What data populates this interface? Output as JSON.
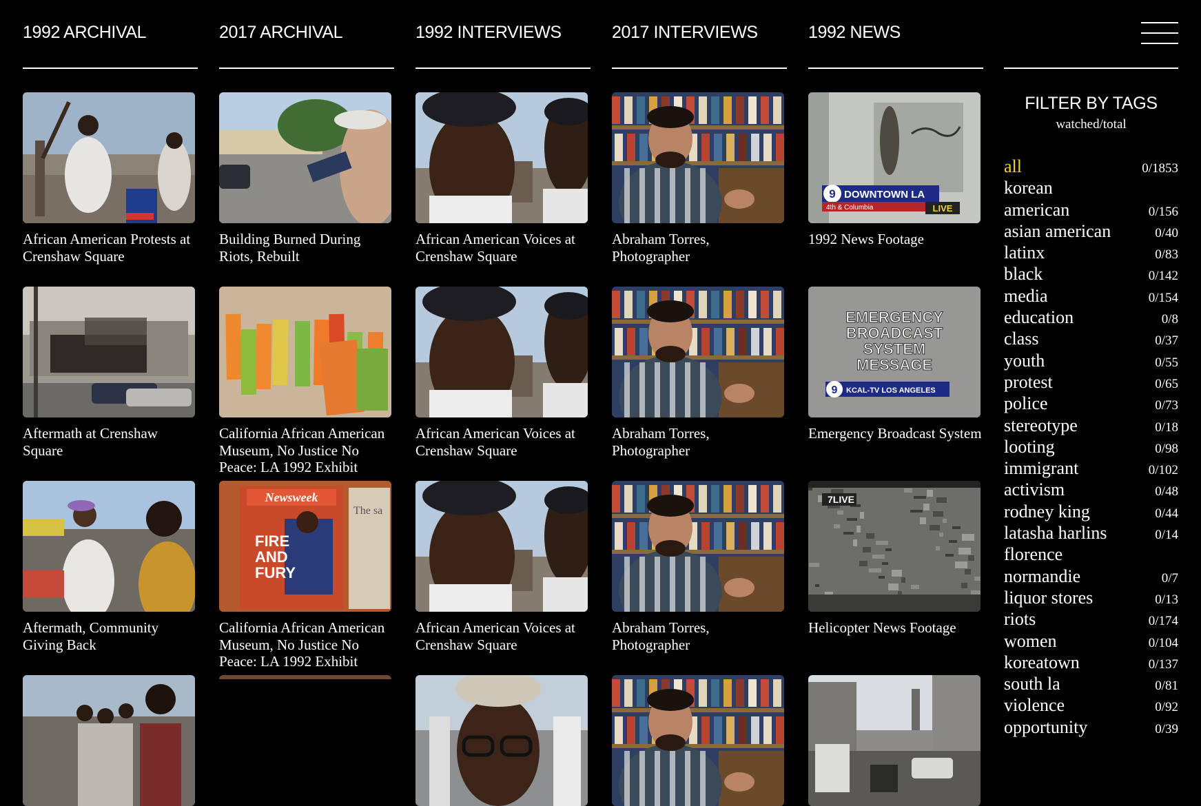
{
  "columns": [
    {
      "title": "1992 ARCHIVAL",
      "cards": [
        {
          "caption": "African American Protests at Crenshaw Square",
          "scene": "protest"
        },
        {
          "caption": "Aftermath at Crenshaw Square",
          "scene": "aftermath"
        },
        {
          "caption": "Aftermath, Community Giving Back",
          "scene": "crowd"
        },
        {
          "caption": "",
          "scene": "crowd2"
        }
      ]
    },
    {
      "title": "2017 ARCHIVAL",
      "cards": [
        {
          "caption": "Building Burned During Riots, Rebuilt",
          "scene": "street"
        },
        {
          "caption": "California African American Museum, No Justice No Peace: LA 1992 Exhibit",
          "scene": "tags"
        },
        {
          "caption": "California African American Museum, No Justice No Peace: LA 1992 Exhibit",
          "scene": "magazine"
        },
        {
          "caption": "",
          "scene": "dark"
        }
      ]
    },
    {
      "title": "1992 INTERVIEWS",
      "cards": [
        {
          "caption": "African American Voices at Crenshaw Square",
          "scene": "face"
        },
        {
          "caption": "African American Voices at Crenshaw Square",
          "scene": "face"
        },
        {
          "caption": "African American Voices at Crenshaw Square",
          "scene": "face"
        },
        {
          "caption": "",
          "scene": "face2"
        }
      ]
    },
    {
      "title": "2017 INTERVIEWS",
      "cards": [
        {
          "caption": "Abraham Torres, Photographer",
          "scene": "books"
        },
        {
          "caption": "Abraham Torres, Photographer",
          "scene": "books"
        },
        {
          "caption": "Abraham Torres, Photographer",
          "scene": "books"
        },
        {
          "caption": "",
          "scene": "books"
        }
      ]
    },
    {
      "title": "1992 NEWS",
      "cards": [
        {
          "caption": "1992 News Footage",
          "scene": "news",
          "overlay": "DOWNTOWN LA",
          "overlay_sub": "4th & Columbia",
          "badge": "LIVE",
          "channel": "9"
        },
        {
          "caption": "Emergency Broadcast System",
          "scene": "ebs",
          "overlay": "EMERGENCY BROADCAST SYSTEM MESSAGE",
          "overlay_sub": "KCAL-TV LOS ANGELES",
          "channel": "9"
        },
        {
          "caption": "Helicopter News Footage",
          "scene": "heli",
          "badge": "LIVE",
          "channel": "7"
        },
        {
          "caption": "",
          "scene": "city"
        }
      ]
    }
  ],
  "menu": {
    "icon": "hamburger-menu-icon"
  },
  "filter": {
    "title": "FILTER BY TAGS",
    "subtitle": "watched/total",
    "tags": [
      {
        "name": "all",
        "count": "0/1853",
        "active": true
      },
      {
        "name": "korean",
        "count": ""
      },
      {
        "name": "american",
        "count": "0/156"
      },
      {
        "name": "asian american",
        "count": "0/40"
      },
      {
        "name": "latinx",
        "count": "0/83"
      },
      {
        "name": "black",
        "count": "0/142"
      },
      {
        "name": "media",
        "count": "0/154"
      },
      {
        "name": "education",
        "count": "0/8"
      },
      {
        "name": "class",
        "count": "0/37"
      },
      {
        "name": "youth",
        "count": "0/55"
      },
      {
        "name": "protest",
        "count": "0/65"
      },
      {
        "name": "police",
        "count": "0/73"
      },
      {
        "name": "stereotype",
        "count": "0/18"
      },
      {
        "name": "looting",
        "count": "0/98"
      },
      {
        "name": "immigrant",
        "count": "0/102"
      },
      {
        "name": "activism",
        "count": "0/48"
      },
      {
        "name": "rodney king",
        "count": "0/44"
      },
      {
        "name": "latasha harlins",
        "count": "0/14"
      },
      {
        "name": "florence",
        "count": ""
      },
      {
        "name": "normandie",
        "count": "0/7"
      },
      {
        "name": "liquor stores",
        "count": "0/13"
      },
      {
        "name": "riots",
        "count": "0/174"
      },
      {
        "name": "women",
        "count": "0/104"
      },
      {
        "name": "koreatown",
        "count": "0/137"
      },
      {
        "name": "south la",
        "count": "0/81"
      },
      {
        "name": "violence",
        "count": "0/92"
      },
      {
        "name": "opportunity",
        "count": "0/39"
      }
    ]
  },
  "colors": {
    "accent": "#f1d230",
    "background": "#000000",
    "text": "#ffffff"
  }
}
